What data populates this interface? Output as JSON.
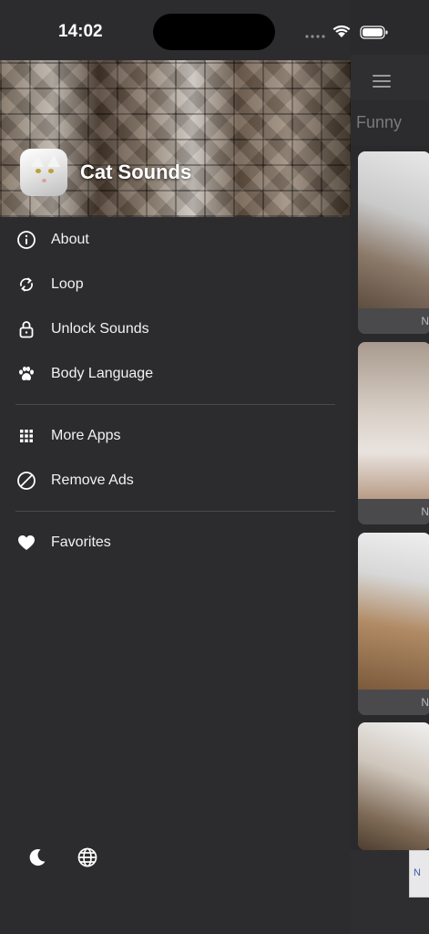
{
  "status_bar": {
    "time": "14:02"
  },
  "header": {
    "app_title": "Cat Sounds"
  },
  "menu": {
    "section1": [
      {
        "label": "About",
        "icon": "info-icon"
      },
      {
        "label": "Loop",
        "icon": "loop-icon"
      },
      {
        "label": "Unlock Sounds",
        "icon": "lock-icon"
      },
      {
        "label": "Body Language",
        "icon": "paw-icon"
      }
    ],
    "section2": [
      {
        "label": "More Apps",
        "icon": "grid-icon"
      },
      {
        "label": "Remove Ads",
        "icon": "block-icon"
      }
    ],
    "section3": [
      {
        "label": "Favorites",
        "icon": "heart-icon"
      }
    ]
  },
  "background_app": {
    "tab_label": "Funny"
  },
  "colors": {
    "drawer_bg": "#2c2c2e",
    "text": "#f2f2f2",
    "divider": "#4a4a4c"
  }
}
